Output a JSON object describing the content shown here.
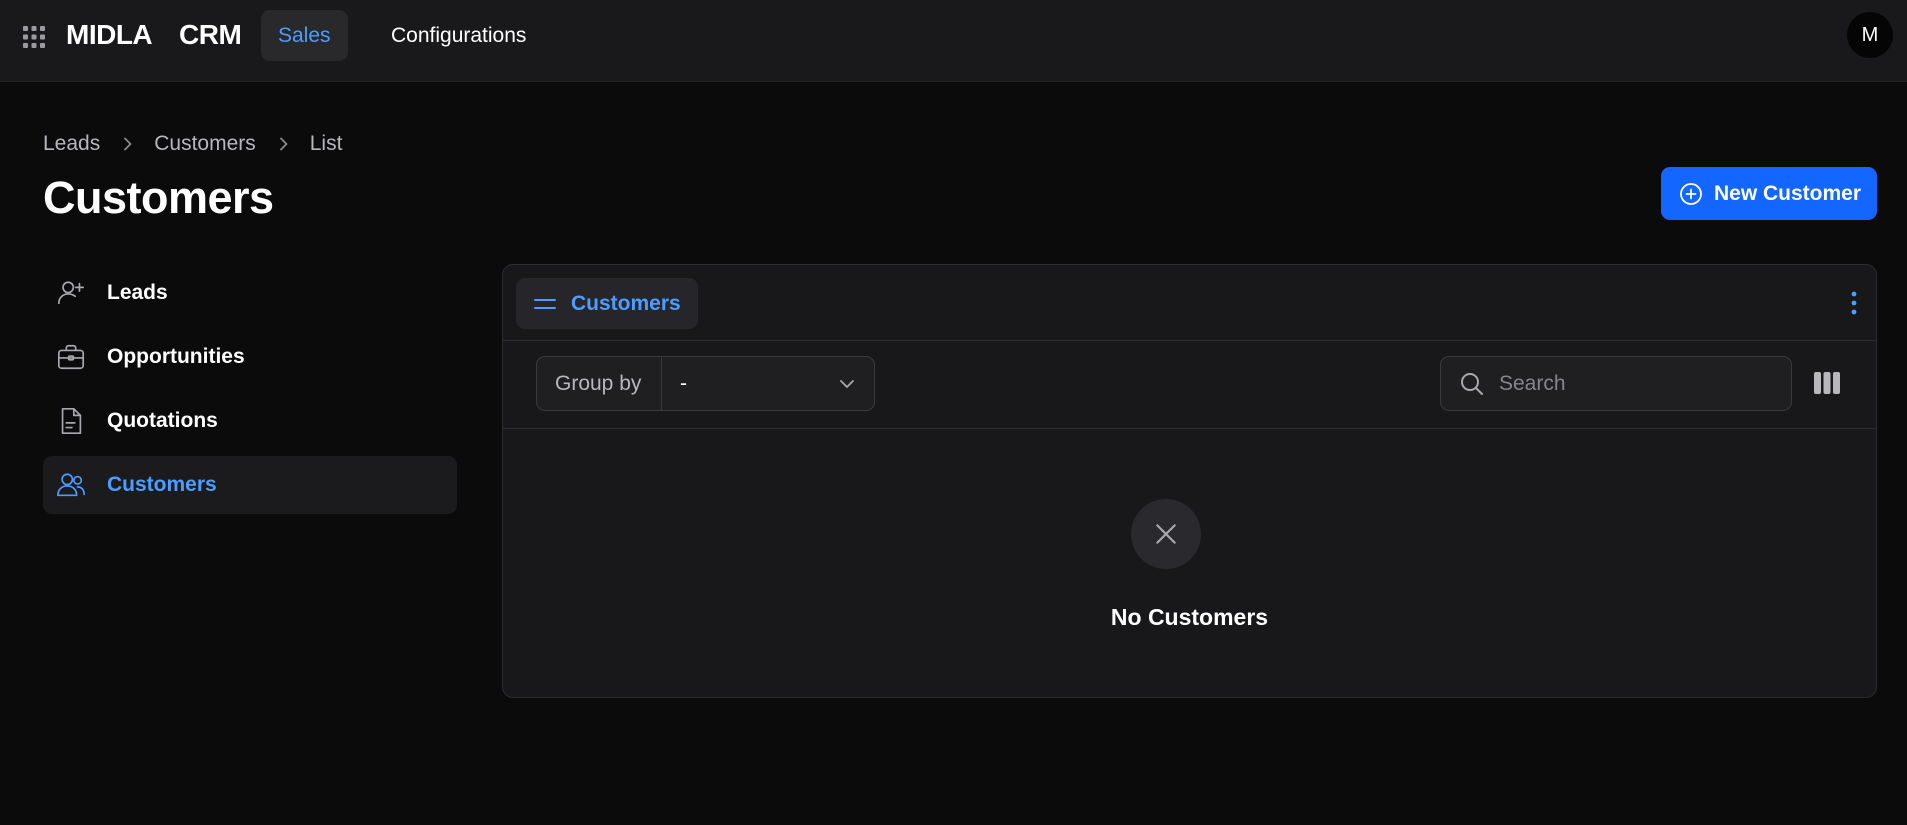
{
  "topbar": {
    "brand_part1": "MIDLA",
    "brand_part2": "CRM",
    "tabs": [
      {
        "label": "Sales",
        "active": true
      },
      {
        "label": "Configurations",
        "active": false
      }
    ],
    "avatar_initial": "M"
  },
  "breadcrumb": [
    "Leads",
    "Customers",
    "List"
  ],
  "page": {
    "title": "Customers",
    "new_button_label": "New Customer"
  },
  "sidebar": {
    "items": [
      {
        "label": "Leads",
        "icon": "user-plus-icon",
        "active": false
      },
      {
        "label": "Opportunities",
        "icon": "briefcase-icon",
        "active": false
      },
      {
        "label": "Quotations",
        "icon": "document-icon",
        "active": false
      },
      {
        "label": "Customers",
        "icon": "users-icon",
        "active": true
      }
    ]
  },
  "panel": {
    "view_tab_label": "Customers",
    "group_by_label": "Group by",
    "group_by_value": "-",
    "search_placeholder": "Search",
    "empty_message": "No Customers"
  },
  "colors": {
    "accent": "#4c9dff",
    "primary_button": "#1366ff",
    "background": "#0b0b0c",
    "surface": "#18181a"
  }
}
